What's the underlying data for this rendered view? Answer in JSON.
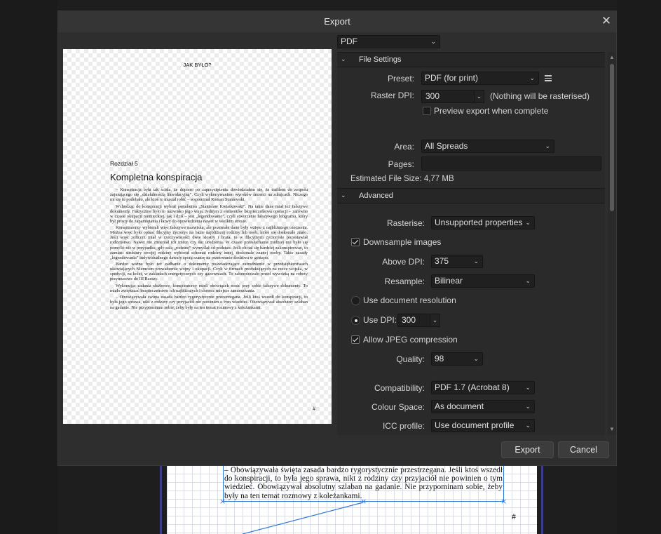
{
  "background": {
    "text_frame_lines": "– Obowiązywała święta zasada bardzo rygorystycznie przestrzegana. Jeśli ktoś wszedł do konspiracji, to była jego sprawa, nikt z rodziny czy przyjaciół nie powinien o tym wiedzieć. Obowiązywał absolutny szlaban na gadanie. Nie przypominam sobie, żeby były na ten temat rozmowy z koleżankami.",
    "page_marker": "#",
    "handle_glyph": "×"
  },
  "dialog": {
    "title": "Export",
    "close_glyph": "✕",
    "format": {
      "value": "PDF"
    }
  },
  "preview": {
    "running_header": "JAK BYŁO?",
    "chapter": "Rozdział 5",
    "heading": "Kompletna konspiracja",
    "paragraphs": [
      "– Konspiracja była tak ścisła, że dopiero po zaprzysiężeniu dowiedziałem się, że trafiłem do zespołu zajmującego się „działalnością likwidacyjną”. Czyli wykonywaniem wyroków śmierci na zdrajcach. Niczego mi się to podobało, ale ktoś to musiał robić – wspominał Roman Staniewski.",
      "Wchodząc do konspiracji wybrał pseudonim „Stanisław Kwiatkowski”. Na takie dane miał też fałszywe dokumenty. Faktycznie było to nazwisko jego wuja. Jednym z elementów bezpieczeństwa operacji – zarówno w czasie okupacji niemieckiej, jak i dziś – jest „legendowanie”, czyli stworzenie fałszywego biogramu, który był prosty do zapamiętania i łatwy do opowiedzenia nawet w wielkim stresie.",
      "Konspiratorzy wybierali więc fałszywe nazwiska, ale pozostałe dane były wzięte z najbliższego otoczenia. Można więc było opisać fikcyjny życiorys na bazie najbliższej rodziny lub osób, które się doskonale znało. Jeśli więc zoficerz miał w rzeczywistości dwie siostry i brata, to w fikcyjnym życiorysie pozostawiał rodzeństwo. Nawet nie zmieniał ich imion czy dat urodzenia. W czasie przesłuchania trudniej mu było się pomylić niż w przypadku, gdy całą „rodzinę” wymyślał od podstaw. Jeśli chciał się bardziej zakonspirować, to zamiast struktury swojej rodziny wybierał schemat rodziny innej, doskonale znanej osoby. Takie zasady „legendowania” indywidualnego dawały sporą szansę na przetrwanie śledztwa w gestapo.",
      "Bardzo ważne było też zadbanie o dokumenty poświadczające zatrudnienie w przedsiębiorstwach ułatwiających Niemcom prowadzenie wojny i okupacji. Czyli w firmach produkujących na rzecz wojska, w spedycji, na kolei, w zakładach energetycznych czy gazowniach. To zabezpieczało przed wywózką na roboty przymusowe do III Rzeszy.",
      "Wykonując zadania służbowe, konspiratorzy mieli obowiązek nosić przy sobie fałszywe dokumenty. To miało zwiększać bezpieczeństwo ich najbliższych i chronić miejsce zamieszkania.",
      "– Obowiązywała święta zasada bardzo rygorystycznie przestrzegana. Jeśli ktoś wszedł do konspiracji, to była jego sprawa, nikt z rodziny czy przyjaciół nie powinien o tym wiedzieć. Obowiązywał absolutny szlaban na gadanie. Nie przypominam sobie, żeby były na ten temat rozmowy z koleżankami."
    ],
    "page_marker": "#"
  },
  "file_settings": {
    "header": "File Settings",
    "preset_label": "Preset:",
    "preset_value": "PDF (for print)",
    "raster_dpi_label": "Raster DPI:",
    "raster_dpi_value": "300",
    "raster_note": "(Nothing will be rasterised)",
    "preview_label": "Preview export when complete",
    "area_label": "Area:",
    "area_value": "All Spreads",
    "pages_label": "Pages:",
    "pages_value": "",
    "file_size": "Estimated File Size: 4,77 MB"
  },
  "advanced": {
    "header": "Advanced",
    "rasterise_label": "Rasterise:",
    "rasterise_value": "Unsupported properties",
    "downsample_label": "Downsample images",
    "above_dpi_label": "Above DPI:",
    "above_dpi_value": "375",
    "resample_label": "Resample:",
    "resample_value": "Bilinear",
    "use_doc_res_label": "Use document resolution",
    "use_dpi_label": "Use DPI:",
    "use_dpi_value": "300",
    "jpeg_label": "Allow JPEG compression",
    "quality_label": "Quality:",
    "quality_value": "98",
    "compat_label": "Compatibility:",
    "compat_value": "PDF 1.7 (Acrobat 8)",
    "colour_space_label": "Colour Space:",
    "colour_space_value": "As document",
    "icc_label": "ICC profile:",
    "icc_value": "Use document profile"
  },
  "buttons": {
    "export": "Export",
    "cancel": "Cancel"
  },
  "glyphs": {
    "chevron_down": "⌄",
    "chevron_up": "▲",
    "chevron_down_small": "▼",
    "arrow_down": "▼",
    "arrow_up": "▲"
  }
}
